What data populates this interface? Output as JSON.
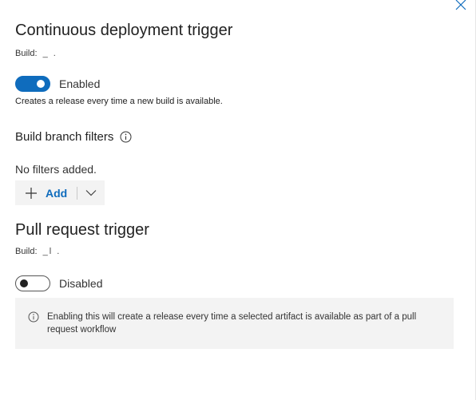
{
  "cd_trigger": {
    "title": "Continuous deployment trigger",
    "build_label": "Build:",
    "build_value": "_ .",
    "toggle_label": "Enabled",
    "toggle_on": true,
    "description": "Creates a release every time a new build is available."
  },
  "branch_filters": {
    "title": "Build branch filters",
    "empty_text": "No filters added.",
    "add_label": "Add"
  },
  "pr_trigger": {
    "title": "Pull request trigger",
    "build_label": "Build:",
    "build_value": "_l .",
    "toggle_label": "Disabled",
    "toggle_on": false,
    "info_text": "Enabling this will create a release every time a selected artifact is available as part of a pull request workflow"
  },
  "icons": {
    "close": "close-icon",
    "info": "info-icon",
    "plus": "plus-icon",
    "chevron": "chevron-down-icon"
  },
  "colors": {
    "accent": "#0f6cbd",
    "surface": "#f3f3f3"
  }
}
